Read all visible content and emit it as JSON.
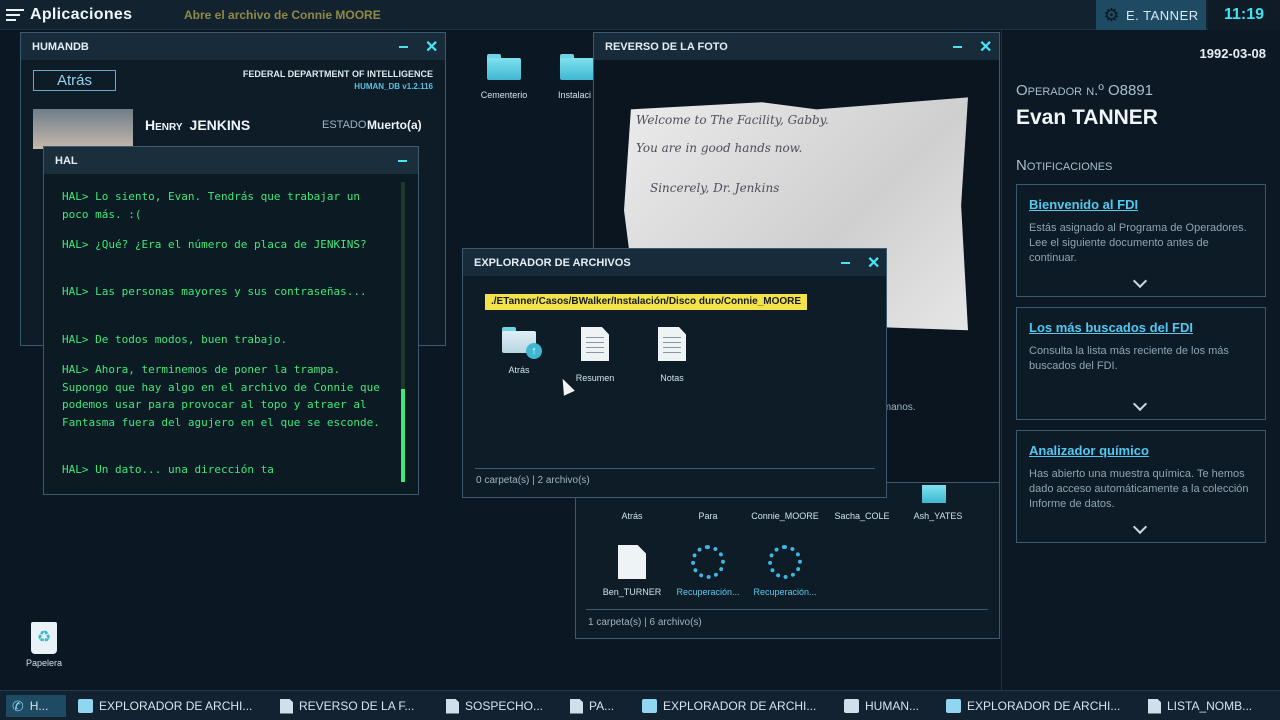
{
  "topbar": {
    "apps_label": "Aplicaciones",
    "objective": "Abre el archivo de Connie MOORE",
    "user": "E. TANNER",
    "clock": "11:19"
  },
  "rightpanel": {
    "date": "1992-03-08",
    "operator_label": "Operador n.º O8891",
    "operator_name": "Evan TANNER",
    "notifications_title": "Notificaciones",
    "cards": [
      {
        "title": "Bienvenido al FDI",
        "body": "Estás asignado al Programa de Operadores. Lee el siguiente documento antes de continuar."
      },
      {
        "title": "Los más buscados del FDI",
        "body": "Consulta la lista más reciente de los más buscados del FDI."
      },
      {
        "title": "Analizador químico",
        "body": "Has abierto una muestra química. Te hemos dado acceso automáticamente a la colección Informe de datos."
      }
    ]
  },
  "desktop": {
    "icons": [
      {
        "label": "Cementerio",
        "icon": "folder-icon"
      },
      {
        "label": "Instalaci",
        "icon": "folder-icon"
      },
      {
        "label": "Papelera",
        "icon": "recycle-bin-icon"
      }
    ]
  },
  "humandb": {
    "title": "HUMANDB",
    "back_label": "Atrás",
    "agency": "FEDERAL DEPARTMENT OF INTELLIGENCE",
    "version": "HUMAN_DB   v1.2.116",
    "person_first": "Henry",
    "person_last": "JENKINS",
    "estado_label": "ESTADO",
    "estado_value": "Muerto(a)"
  },
  "hal": {
    "title": "HAL",
    "lines": [
      "HAL> Lo siento, Evan. Tendrás que trabajar un poco más. :(",
      "HAL> ¿Qué? ¿Era el número de placa de JENKINS?",
      "HAL> Las personas mayores y sus contraseñas...",
      "HAL> De todos modos, buen trabajo.",
      "HAL> Ahora, terminemos de poner la trampa. Supongo que hay algo en el archivo de Connie que podemos usar para provocar al topo y atraer al Fantasma fuera del agujero en el que se esconde.",
      "HAL> Un dato... una dirección ta"
    ]
  },
  "photo": {
    "title": "REVERSO DE LA FOTO",
    "note_lines": [
      "Welcome to The Facility, Gabby.",
      "You are in good hands now.",
      "Sincerely, Dr. Jenkins"
    ],
    "caption_fragment": "s manos."
  },
  "explorer": {
    "title": "EXPLORADOR DE ARCHIVOS",
    "path": "./ETanner/Casos/BWalker/Instalación/Disco duro/Connie_MOORE",
    "items": [
      {
        "label": "Atrás",
        "icon": "folder-back-icon"
      },
      {
        "label": "Resumen",
        "icon": "document-icon"
      },
      {
        "label": "Notas",
        "icon": "document-icon"
      }
    ],
    "status": "0 carpeta(s) | 2 archivo(s)"
  },
  "explorer2": {
    "row1": [
      "Atrás",
      "Para",
      "Connie_MOORE",
      "Sacha_COLE",
      "Ash_YATES"
    ],
    "row2": [
      "Ben_TURNER",
      "Recuperación...",
      "Recuperación..."
    ],
    "status": "1 carpeta(s) | 6 archivo(s)"
  },
  "taskbar": {
    "items": [
      {
        "label": "H...",
        "icon": "phone-icon"
      },
      {
        "label": "EXPLORADOR DE ARCHI...",
        "icon": "folder-icon"
      },
      {
        "label": "REVERSO DE LA F...",
        "icon": "image-icon"
      },
      {
        "label": "SOSPECHO...",
        "icon": "image-icon"
      },
      {
        "label": "PA...",
        "icon": "document-icon"
      },
      {
        "label": "EXPLORADOR DE ARCHI...",
        "icon": "folder-icon"
      },
      {
        "label": "HUMAN...",
        "icon": "id-card-icon"
      },
      {
        "label": "EXPLORADOR DE ARCHI...",
        "icon": "folder-icon"
      },
      {
        "label": "LISTA_NOMB...",
        "icon": "document-icon"
      }
    ]
  },
  "colors": {
    "accent": "#48e6f0",
    "console_green": "#3fe87a",
    "path_highlight": "#f3e34a",
    "link_blue": "#54c8f0"
  }
}
